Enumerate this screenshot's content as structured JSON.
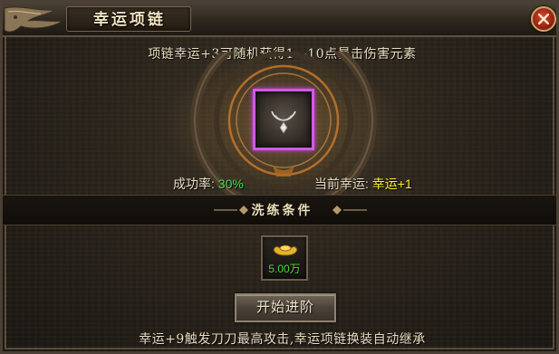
{
  "window": {
    "title": "幸运项链"
  },
  "description_top": "项链幸运+3可随机获得1—10点暴击伤害元素",
  "stats": {
    "success_label": "成功率:",
    "success_value": "30%",
    "luck_label": "当前幸运:",
    "luck_value": "幸运+1"
  },
  "section": {
    "title": "洗练条件"
  },
  "cost": {
    "amount": "5.00万",
    "icon": "gold-ingot-icon"
  },
  "buttons": {
    "upgrade_label": "开始进阶"
  },
  "description_bottom": "幸运+9触发刀刀最高攻击,幸运项链换装自动继承",
  "colors": {
    "success": "#43e04a",
    "luck": "#ffee3a",
    "slot_border": "#d15ae6",
    "cost": "#4dd94a"
  }
}
